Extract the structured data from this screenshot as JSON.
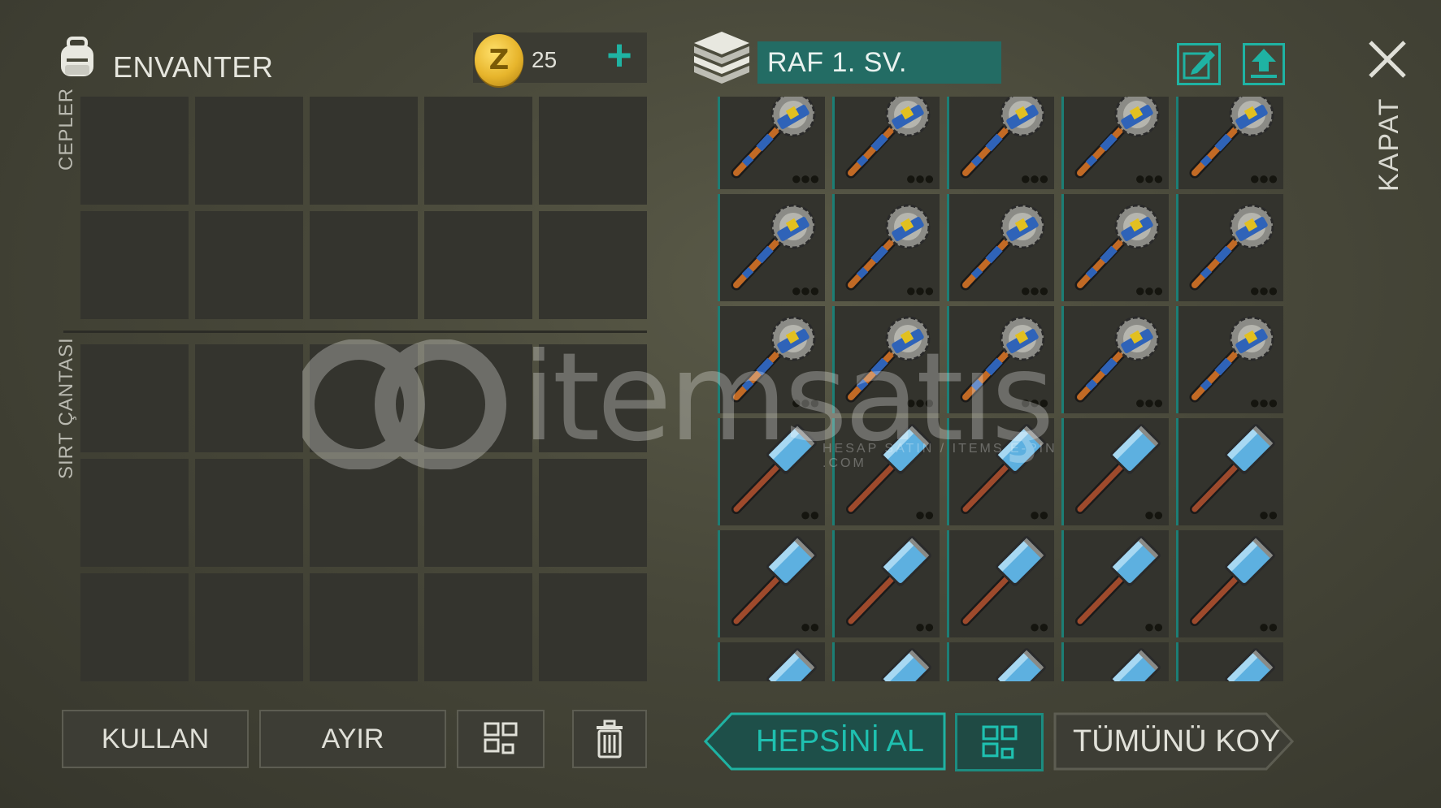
{
  "header": {
    "title": "ENVANTER",
    "coins": "25"
  },
  "left": {
    "pockets_label": "CEPLER",
    "backpack_label": "SIRT ÇANTASI",
    "pocket_slots": 10,
    "backpack_slots": 15
  },
  "left_buttons": {
    "use": "KULLAN",
    "split": "AYIR"
  },
  "storage": {
    "name": "RAF 1. SV.",
    "rows": [
      [
        "saw-mace",
        "saw-mace",
        "saw-mace",
        "saw-mace",
        "saw-mace"
      ],
      [
        "saw-mace",
        "saw-mace",
        "saw-mace",
        "saw-mace",
        "saw-mace"
      ],
      [
        "saw-mace",
        "saw-mace",
        "saw-mace",
        "saw-mace",
        "saw-mace"
      ],
      [
        "sledgehammer",
        "sledgehammer",
        "sledgehammer",
        "sledgehammer",
        "sledgehammer"
      ],
      [
        "sledgehammer",
        "sledgehammer",
        "sledgehammer",
        "sledgehammer",
        "sledgehammer"
      ],
      [
        "sledgehammer",
        "sledgehammer",
        "sledgehammer",
        "sledgehammer",
        "sledgehammer"
      ]
    ]
  },
  "right_buttons": {
    "take_all": "HEPSİNİ AL",
    "put_all": "TÜMÜNÜ KOY"
  },
  "close": {
    "label": "KAPAT"
  },
  "watermark": {
    "brand": "itemsatış",
    "tagline": "HESAP SATIN / ITEMS E-PIN .COM"
  },
  "colors": {
    "accent": "#1fb3a3",
    "storage_header": "#236c64",
    "coin": "#e7b52c"
  },
  "icons": [
    "backpack-icon",
    "coin-icon",
    "plus-icon",
    "storage-stack-icon",
    "edit-icon",
    "upload-icon",
    "grid-icon",
    "trash-icon",
    "close-icon"
  ]
}
